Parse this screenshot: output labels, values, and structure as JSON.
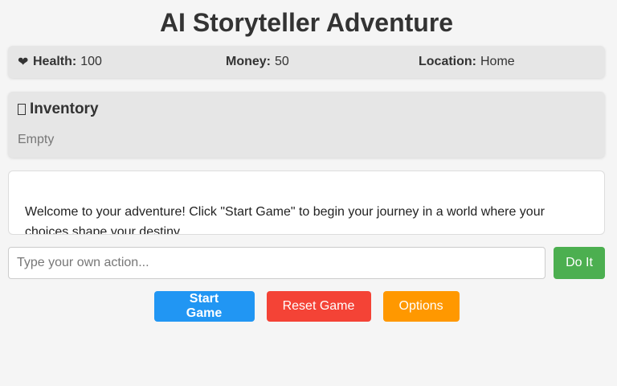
{
  "header": {
    "title": "AI Storyteller Adventure"
  },
  "stats": {
    "health": {
      "icon": "❤",
      "label": "Health:",
      "value": "100"
    },
    "money": {
      "icon": "",
      "label": "Money:",
      "value": "50"
    },
    "location": {
      "icon": "",
      "label": "Location:",
      "value": "Home"
    }
  },
  "inventory": {
    "icon": "",
    "heading": "Inventory",
    "empty_text": "Empty"
  },
  "story": {
    "text": "Welcome to your adventure! Click \"Start Game\" to begin your journey in a world where your choices shape your destiny."
  },
  "action": {
    "placeholder": "Type your own action...",
    "value": "",
    "do_label": "Do It"
  },
  "controls": {
    "start_label": "Start Game",
    "reset_label": "Reset Game",
    "options_label": "Options"
  },
  "colors": {
    "start": "#2196f3",
    "reset": "#f44336",
    "options": "#ff9800",
    "do_it": "#4caf50"
  }
}
